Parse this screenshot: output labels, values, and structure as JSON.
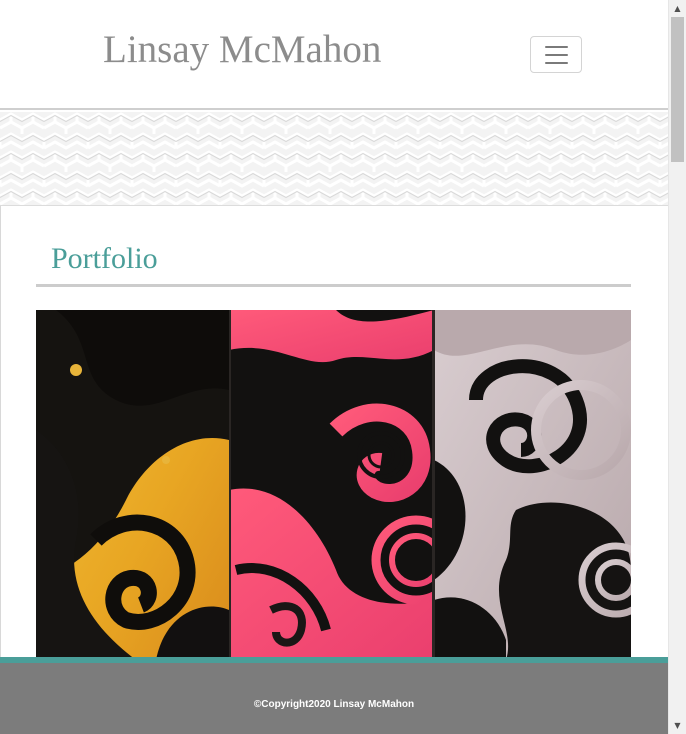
{
  "header": {
    "site_title": "Linsay McMahon",
    "menu_icon": "hamburger-icon"
  },
  "banner": {
    "pattern": "grey-geometric-chevron-pattern"
  },
  "main": {
    "section_title": "Portfolio",
    "artwork_image": "abstract-painting-yellow-pink-black-white"
  },
  "footer": {
    "copyright": "©Copyright2020 Linsay McMahon"
  },
  "colors": {
    "accent": "#4a9e99",
    "title_grey": "#8c8c8c",
    "footer_bg": "#7c7c7c"
  },
  "scrollbar": {
    "up_icon": "scroll-up-arrow-icon",
    "down_icon": "scroll-down-arrow-icon"
  }
}
